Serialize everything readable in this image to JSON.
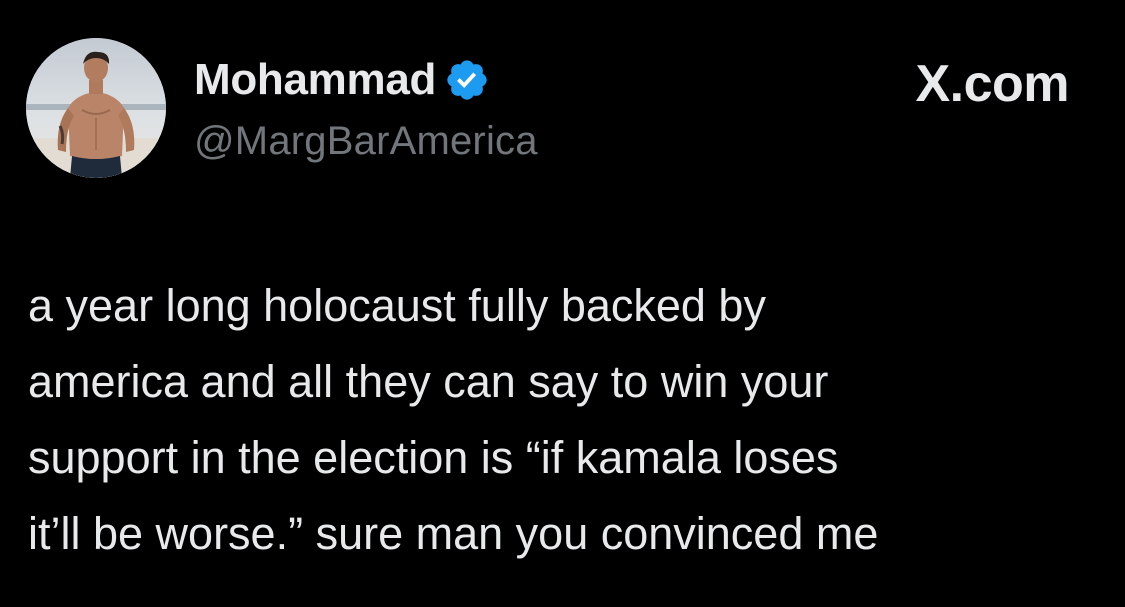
{
  "author": {
    "display_name": "Mohammad",
    "handle": "@MargBarAmerica",
    "verified": true,
    "verified_badge_color": "#1d9bf0",
    "avatar_icon": "profile-photo"
  },
  "watermark": {
    "text": "X.com"
  },
  "tweet": {
    "lines": [
      "a year long holocaust fully backed by",
      "america and all they can say to win your",
      "support in the election is “if kamala loses",
      "it’ll be worse.” sure man you convinced me"
    ]
  },
  "colors": {
    "background": "#000000",
    "primary_text": "#e7e9ea",
    "secondary_text": "#71767b"
  }
}
